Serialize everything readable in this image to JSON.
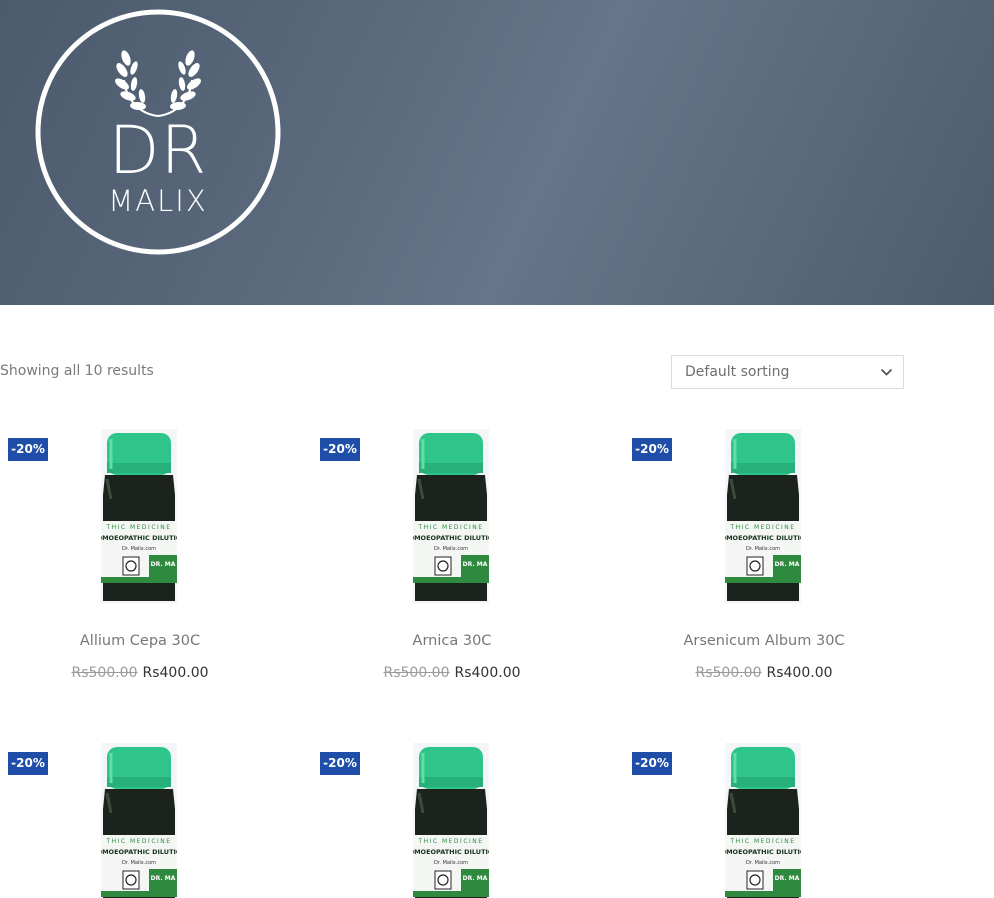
{
  "logo": {
    "line1": "DR",
    "line2": "MALIX"
  },
  "toolbar": {
    "result_count": "Showing all 10 results",
    "sort_selected": "Default sorting"
  },
  "products": [
    {
      "name": "Allium Cepa 30C",
      "badge": "-20%",
      "old_price": "Rs500.00",
      "price": "Rs400.00"
    },
    {
      "name": "Arnica 30C",
      "badge": "-20%",
      "old_price": "Rs500.00",
      "price": "Rs400.00"
    },
    {
      "name": "Arsenicum Album 30C",
      "badge": "-20%",
      "old_price": "Rs500.00",
      "price": "Rs400.00"
    },
    {
      "badge": "-20%"
    },
    {
      "badge": "-20%"
    },
    {
      "badge": "-20%"
    }
  ],
  "bottle_label": {
    "line1": "THIC MEDICINE",
    "line2": "HOMOEOPATHIC DILUTION",
    "line3": "Dr. Malix.com",
    "brand": "DR. MA"
  },
  "colors": {
    "header_bg": "#55657a",
    "badge_bg": "#1f4ea8",
    "cap": "#2fc48a",
    "label_green": "#2e8a3e"
  }
}
